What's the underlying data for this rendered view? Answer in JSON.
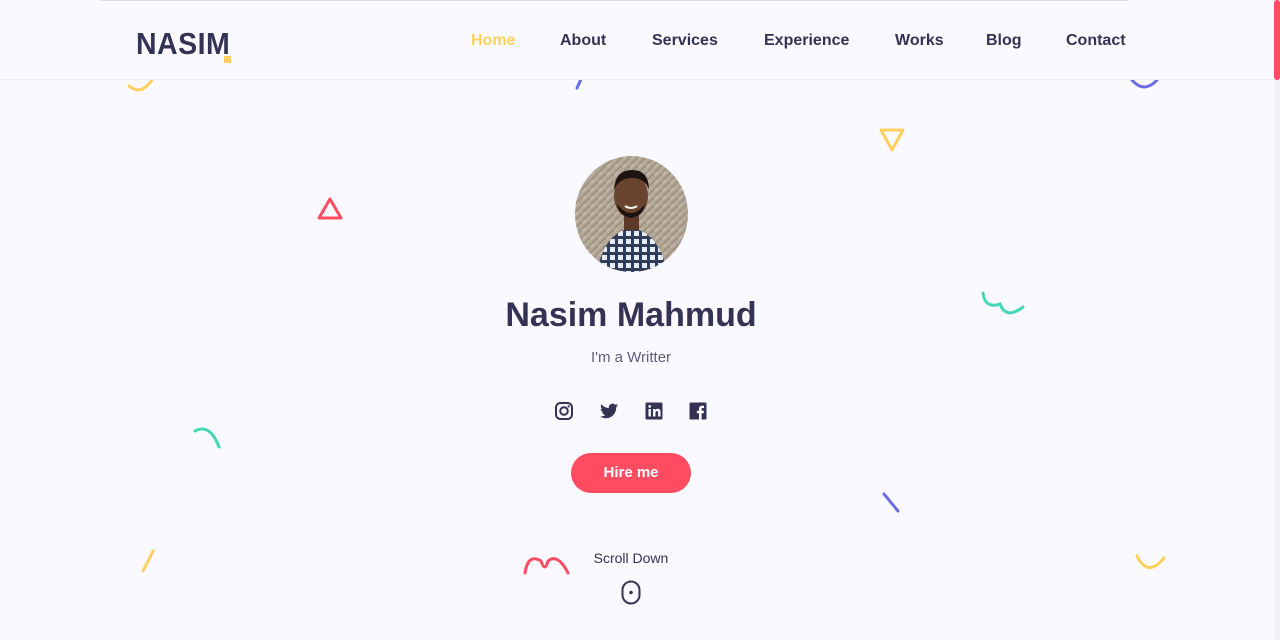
{
  "brand": {
    "logo_text": "NASIM",
    "accent": "#ffd15c"
  },
  "nav": {
    "items": [
      {
        "label": "Home",
        "active": true
      },
      {
        "label": "About",
        "active": false
      },
      {
        "label": "Services",
        "active": false
      },
      {
        "label": "Experience",
        "active": false
      },
      {
        "label": "Works",
        "active": false
      },
      {
        "label": "Blog",
        "active": false
      },
      {
        "label": "Contact",
        "active": false
      }
    ]
  },
  "hero": {
    "name": "Nasim Mahmud",
    "subtitle": "I'm a Writter",
    "socials": [
      "instagram-icon",
      "twitter-icon",
      "linkedin-icon",
      "facebook-icon"
    ],
    "cta_label": "Hire me",
    "scroll_label": "Scroll Down"
  },
  "colors": {
    "primary": "#ff4c60",
    "heading": "#353353",
    "yellow": "#ffd15c",
    "teal": "#44d7b6",
    "purple": "#6c6ce5",
    "background": "#f9f9ff"
  }
}
